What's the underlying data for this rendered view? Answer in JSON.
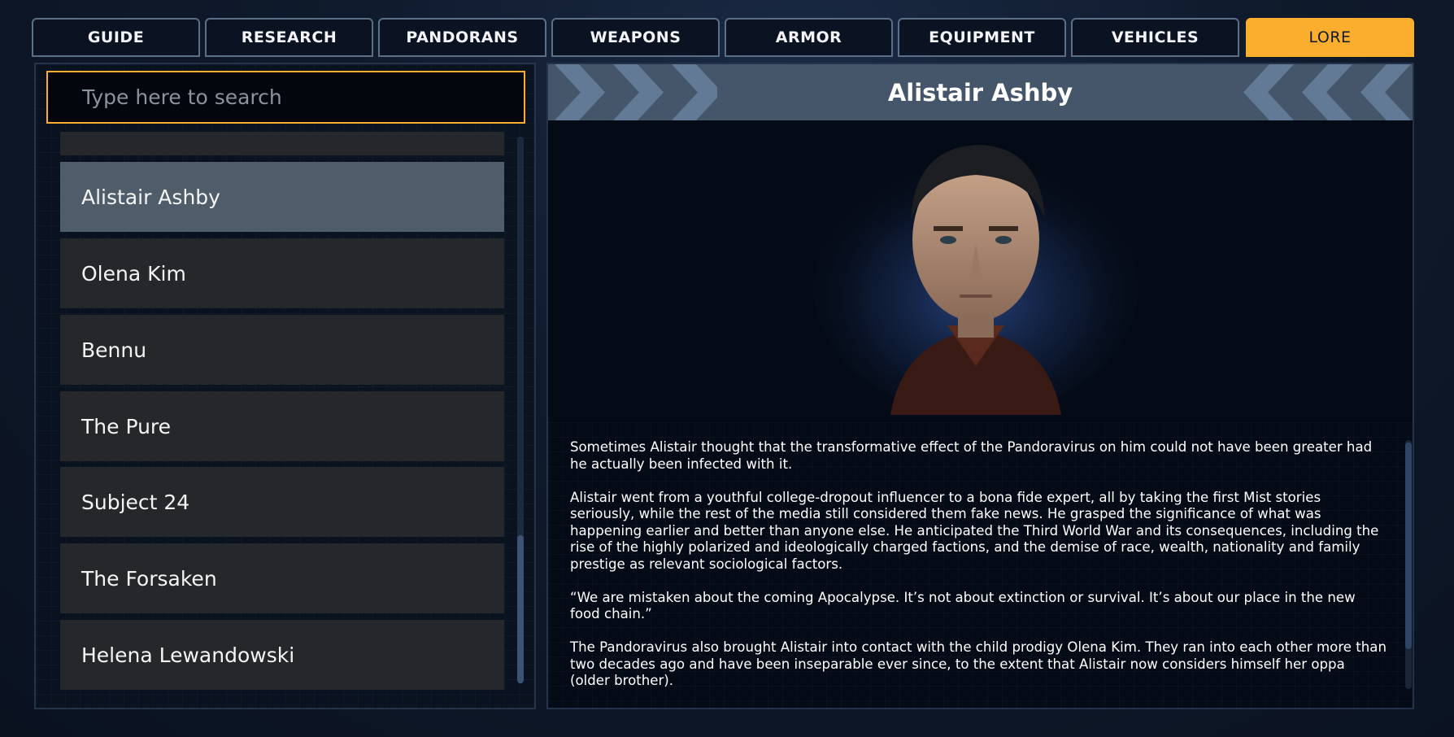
{
  "tabs": [
    {
      "label": "GUIDE"
    },
    {
      "label": "RESEARCH"
    },
    {
      "label": "PANDORANS"
    },
    {
      "label": "WEAPONS"
    },
    {
      "label": "ARMOR"
    },
    {
      "label": "EQUIPMENT"
    },
    {
      "label": "VEHICLES"
    },
    {
      "label": "LORE",
      "active": true
    }
  ],
  "search": {
    "placeholder": "Type here to search",
    "value": ""
  },
  "list": {
    "items": [
      {
        "label": ""
      },
      {
        "label": "Alistair Ashby",
        "selected": true
      },
      {
        "label": "Olena Kim"
      },
      {
        "label": "Bennu"
      },
      {
        "label": "The Pure"
      },
      {
        "label": "Subject 24"
      },
      {
        "label": "The Forsaken"
      },
      {
        "label": "Helena Lewandowski"
      }
    ]
  },
  "detail": {
    "title": "Alistair Ashby",
    "portrait": "portrait-icon",
    "paragraphs": [
      "Sometimes Alistair thought that the transformative effect of the Pandoravirus on him could not have been greater had he actually been infected with it.",
      "Alistair went from a youthful college-dropout influencer to a bona fide expert, all by taking the first Mist stories seriously, while the rest of the media still considered them fake news. He grasped the significance of what was happening earlier and better than anyone else. He anticipated the Third World War and its consequences, including the rise of the highly polarized and ideologically charged factions, and the demise of race, wealth, nationality and family prestige as relevant sociological factors.",
      "“We are mistaken about the coming Apocalypse. It’s not about extinction or survival. It’s about our place in the new food chain.”",
      "The Pandoravirus also brought Alistair into contact with the child prodigy Olena Kim. They ran into each other more than two decades ago and have been inseparable ever since, to the extent that Alistair now considers himself her oppa (older brother)."
    ]
  },
  "colors": {
    "accent": "#fbae2d",
    "tab_bg": "#0b1322",
    "tab_border": "#5b6f87",
    "item_bg": "#25272b",
    "item_selected_bg": "#4f5c69",
    "header_bg": "#45566b"
  }
}
